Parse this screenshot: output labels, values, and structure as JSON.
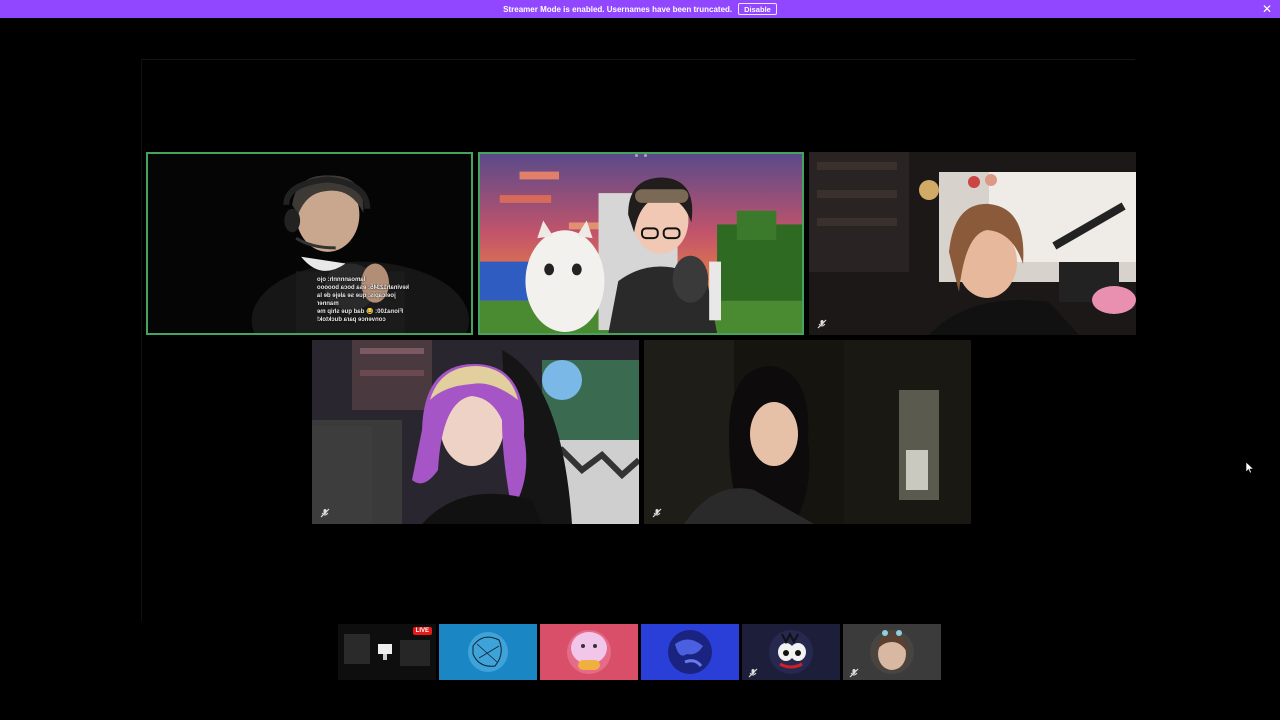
{
  "banner": {
    "message": "Streamer Mode is enabled. Usernames have been truncated.",
    "disable_label": "Disable",
    "close_glyph": "✕",
    "bg_color": "#9146ff"
  },
  "stage": {
    "speaking_color": "#46a35e",
    "tiles": [
      {
        "id": "tile-1",
        "speaking": true,
        "muted": false
      },
      {
        "id": "tile-2",
        "speaking": true,
        "muted": false
      },
      {
        "id": "tile-3",
        "speaking": false,
        "muted": true
      },
      {
        "id": "tile-4",
        "speaking": false,
        "muted": true
      },
      {
        "id": "tile-5",
        "speaking": false,
        "muted": true
      }
    ],
    "chat_overlay": [
      "lamoannnnh: ojo",
      "kevinah12345: esa boca booooo",
      "joelcapis: que se aleje de la",
      "manner",
      "Fiona100: 😂 dad que ship me",
      "convence para ducktok!"
    ]
  },
  "strip": {
    "live_label": "LIVE",
    "items": [
      {
        "id": "screen-share",
        "live": true,
        "muted": false,
        "color": "#1a1a1a"
      },
      {
        "id": "avatar-blue-sketch",
        "live": false,
        "muted": false,
        "color": "#1b86c4"
      },
      {
        "id": "avatar-pink-blob",
        "live": false,
        "muted": false,
        "color": "#d94f6a"
      },
      {
        "id": "avatar-blue-earth",
        "live": false,
        "muted": false,
        "color": "#2a3fd8"
      },
      {
        "id": "avatar-dark-character",
        "live": false,
        "muted": true,
        "color": "#1d1e3a"
      },
      {
        "id": "avatar-photo",
        "live": false,
        "muted": true,
        "color": "#3b3b3b"
      }
    ]
  },
  "icons": {
    "mute": "microphone-muted-icon",
    "close": "close-icon",
    "cursor": "mouse-cursor-icon"
  }
}
